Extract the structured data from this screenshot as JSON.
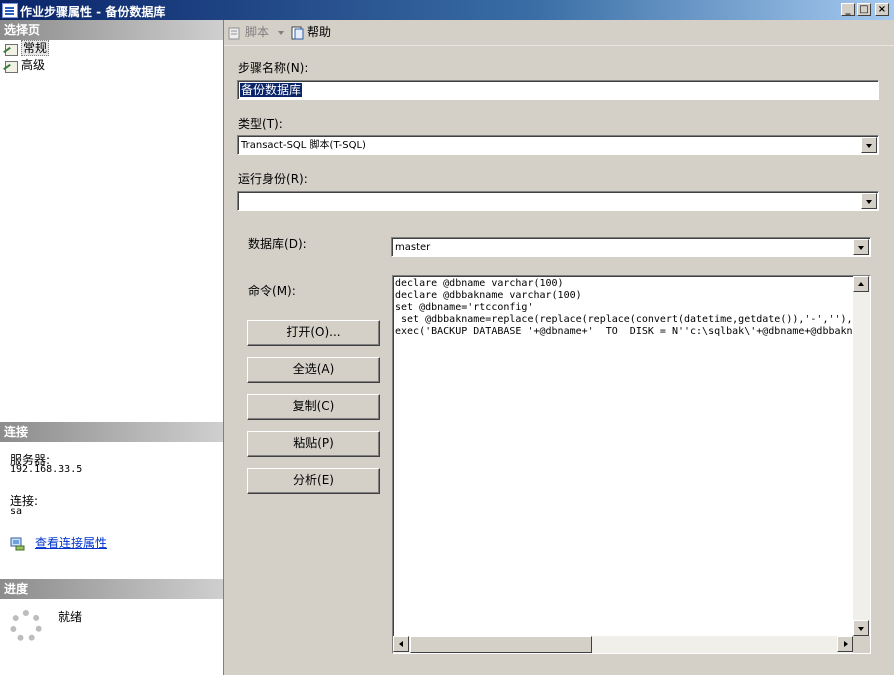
{
  "window": {
    "title": "作业步骤属性 - 备份数据库",
    "minimize": "_",
    "maximize": "□",
    "close": "×"
  },
  "sidebar": {
    "select_page_header": "选择页",
    "pages": [
      {
        "label": "常规",
        "icon": "page-icon"
      },
      {
        "label": "高级",
        "icon": "page-icon"
      }
    ],
    "connection_header": "连接",
    "server_label": "服务器:",
    "server_value": "192.168.33.5",
    "connection_label": "连接:",
    "connection_value": "sa",
    "view_connection_link": "查看连接属性",
    "progress_header": "进度",
    "progress_status": "就绪"
  },
  "toolbar": {
    "script_label": "脚本",
    "help_label": "帮助"
  },
  "form": {
    "step_name_label": "步骤名称",
    "step_name_key": "(N)",
    "step_name_value": "备份数据库",
    "type_label": "类型",
    "type_key": "(T)",
    "type_value": "Transact-SQL 脚本(T-SQL)",
    "run_as_label": "运行身份",
    "run_as_key": "(R)",
    "run_as_value": "",
    "database_label": "数据库",
    "database_key": "(D)",
    "database_value": "master",
    "command_label": "命令",
    "command_key": "(M)",
    "command_text": "declare @dbname varchar(100)\ndeclare @dbbakname varchar(100)\nset @dbname='rtcconfig'\n set @dbbakname=replace(replace(replace(convert(datetime,getdate()),'-',''),\nexec('BACKUP DATABASE '+@dbname+'  TO  DISK = N''c:\\sqlbak\\'+@dbname+@dbbaknam"
  },
  "buttons": {
    "open": "打开(O)...",
    "select_all": "全选(A)",
    "copy": "复制(C)",
    "paste": "粘贴(P)",
    "parse": "分析(E)"
  }
}
